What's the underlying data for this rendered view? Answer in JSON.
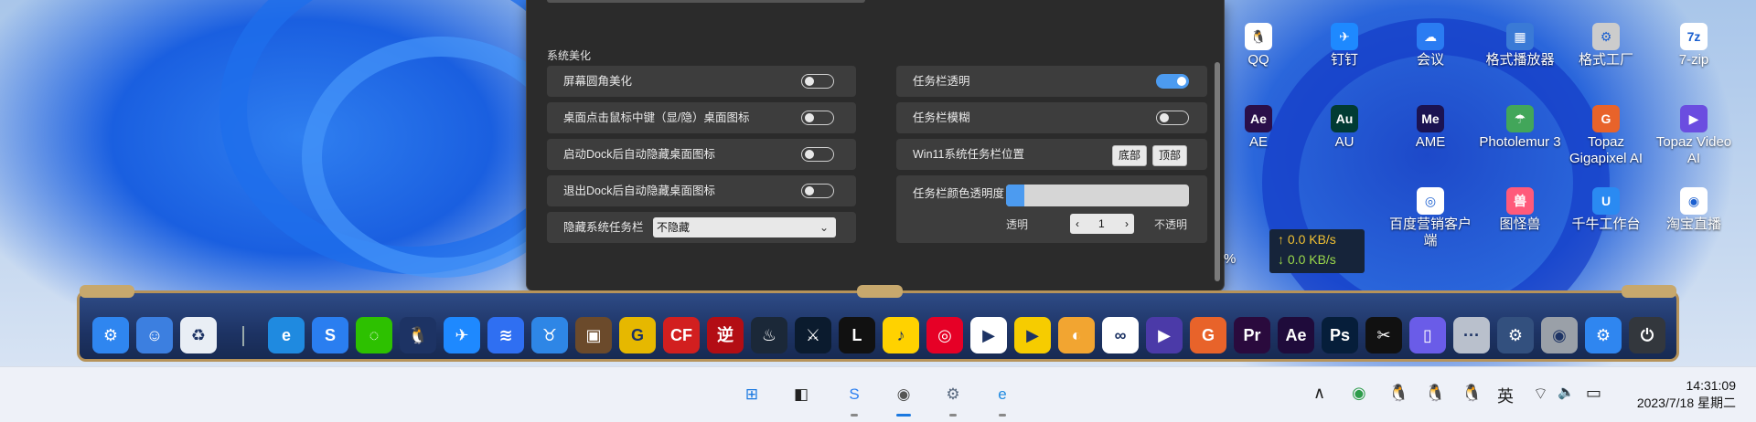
{
  "panel": {
    "section_title": "系统美化",
    "left_rows": [
      {
        "label": "屏幕圆角美化",
        "on": false
      },
      {
        "label": "桌面点击鼠标中键（显/隐）桌面图标",
        "on": false
      },
      {
        "label": "启动Dock后自动隐藏桌面图标",
        "on": false
      },
      {
        "label": "退出Dock后自动隐藏桌面图标",
        "on": false
      }
    ],
    "hide_taskbar": {
      "label": "隐藏系统任务栏",
      "value": "不隐藏"
    },
    "right_rows": [
      {
        "label": "任务栏透明",
        "on": true
      },
      {
        "label": "任务栏模糊",
        "on": false
      }
    ],
    "position": {
      "label": "Win11系统任务栏位置",
      "opt1": "底部",
      "opt2": "顶部"
    },
    "opacity": {
      "label": "任务栏颜色透明度",
      "level": 0.1,
      "min_label": "透明",
      "max_label": "不透明",
      "value": "1",
      "dec": "‹",
      "inc": "›"
    }
  },
  "desktop_icons": [
    {
      "label": "QQ",
      "glyph": "🐧",
      "color": "#ffffff"
    },
    {
      "label": "钉钉",
      "glyph": "✈",
      "color": "#1e89ff"
    },
    {
      "label": "会议",
      "glyph": "☁",
      "color": "#2a7cf2"
    },
    {
      "label": "格式播放器",
      "glyph": "▦",
      "color": "#3a7ad6"
    },
    {
      "label": "格式工厂",
      "glyph": "⚙",
      "color": "#cccccc"
    },
    {
      "label": "7-zip",
      "glyph": "7z",
      "color": "#ffffff"
    },
    {
      "label": "AE",
      "glyph": "Ae",
      "color": "#2a0f4a"
    },
    {
      "label": "AU",
      "glyph": "Au",
      "color": "#013b33"
    },
    {
      "label": "AME",
      "glyph": "Me",
      "color": "#1b1352"
    },
    {
      "label": "Photolemur 3",
      "glyph": "☂",
      "color": "#42a65a"
    },
    {
      "label": "Topaz Gigapixel AI",
      "glyph": "G",
      "color": "#e8632a"
    },
    {
      "label": "Topaz Video AI",
      "glyph": "▶",
      "color": "#6b4de0"
    },
    {
      "label": "百度营销客户端",
      "glyph": "◎",
      "color": "#ffffff"
    },
    {
      "label": "图怪兽",
      "glyph": "兽",
      "color": "#ff5a7a"
    },
    {
      "label": "千牛工作台",
      "glyph": "U",
      "color": "#2a8af2"
    },
    {
      "label": "淘宝直播",
      "glyph": "◉",
      "color": "#ffffff"
    }
  ],
  "net": {
    "up": "↑ 0.0 KB/s",
    "down": "↓ 0.0 KB/s"
  },
  "percent_fragment": "%",
  "dock_icons": [
    {
      "name": "settings",
      "glyph": "⚙",
      "color": "#2f86f0"
    },
    {
      "name": "finder",
      "glyph": "☺",
      "color": "#3c7fe0"
    },
    {
      "name": "recycle-bin",
      "glyph": "♻",
      "color": "#e9eef5"
    },
    {
      "name": "edge",
      "glyph": "e",
      "color": "#1f8ae0"
    },
    {
      "name": "sogou",
      "glyph": "S",
      "color": "#2a7ef0"
    },
    {
      "name": "wechat",
      "glyph": "◌",
      "color": "#2dc100"
    },
    {
      "name": "qq",
      "glyph": "🐧",
      "color": "#1d3364"
    },
    {
      "name": "dingtalk",
      "glyph": "✈",
      "color": "#1e89ff"
    },
    {
      "name": "lark",
      "glyph": "≋",
      "color": "#2f6ff2"
    },
    {
      "name": "cow-app",
      "glyph": "♉",
      "color": "#2e86e6"
    },
    {
      "name": "minecraft",
      "glyph": "▣",
      "color": "#6b4a2b"
    },
    {
      "name": "gamepad-app",
      "glyph": "G",
      "color": "#e6b800"
    },
    {
      "name": "crossfire",
      "glyph": "CF",
      "color": "#d21f1f"
    },
    {
      "name": "game-nirvana",
      "glyph": "逆",
      "color": "#b30d14"
    },
    {
      "name": "steam",
      "glyph": "♨",
      "color": "#1b2838"
    },
    {
      "name": "league",
      "glyph": "⚔",
      "color": "#0b1b2e"
    },
    {
      "name": "launcher-L",
      "glyph": "L",
      "color": "#111111"
    },
    {
      "name": "qq-music",
      "glyph": "♪",
      "color": "#ffd200"
    },
    {
      "name": "netease-music",
      "glyph": "◎",
      "color": "#e60026"
    },
    {
      "name": "video-player",
      "glyph": "▶",
      "color": "#ffffff"
    },
    {
      "name": "potplayer",
      "glyph": "▶",
      "color": "#f6cc00"
    },
    {
      "name": "game-app",
      "glyph": "◐",
      "color": "#f2a531"
    },
    {
      "name": "baidu-netdisk",
      "glyph": "∞",
      "color": "#ffffff"
    },
    {
      "name": "topaz-video",
      "glyph": "▶",
      "color": "#4b3aa8"
    },
    {
      "name": "topaz-gigapixel",
      "glyph": "G",
      "color": "#e8632a"
    },
    {
      "name": "premiere",
      "glyph": "Pr",
      "color": "#2a0a3d"
    },
    {
      "name": "after-effects",
      "glyph": "Ae",
      "color": "#1f0b3b"
    },
    {
      "name": "photoshop",
      "glyph": "Ps",
      "color": "#061e3a"
    },
    {
      "name": "capcut",
      "glyph": "✂",
      "color": "#111111"
    },
    {
      "name": "phone-app",
      "glyph": "▯",
      "color": "#6a5ce8"
    },
    {
      "name": "more",
      "glyph": "···",
      "color": "#b9c0cc"
    },
    {
      "name": "gear-app",
      "glyph": "⚙",
      "color": "#33507e"
    },
    {
      "name": "steam-circle",
      "glyph": "◉",
      "color": "#9aa0a8"
    },
    {
      "name": "settings-2",
      "glyph": "⚙",
      "color": "#2f86f0"
    },
    {
      "name": "power",
      "glyph": "⏻",
      "color": "#33373d"
    }
  ],
  "taskbar_apps": [
    {
      "name": "start",
      "glyph": "⊞",
      "color": "#1a78e0"
    },
    {
      "name": "task-view",
      "glyph": "◧",
      "color": "#222222"
    },
    {
      "name": "sogou",
      "glyph": "S",
      "color": "#2a7ef0"
    },
    {
      "name": "steam-dock",
      "glyph": "◉",
      "color": "#555555"
    },
    {
      "name": "settings",
      "glyph": "⚙",
      "color": "#5a6a80"
    },
    {
      "name": "edge",
      "glyph": "e",
      "color": "#1f8ae0"
    }
  ],
  "tray": {
    "chevron": "∧",
    "ime": "英",
    "wifi": "⌔",
    "volume": "🔈",
    "battery": "▭"
  },
  "clock": {
    "time": "14:31:09",
    "date": "2023/7/18 星期二"
  }
}
